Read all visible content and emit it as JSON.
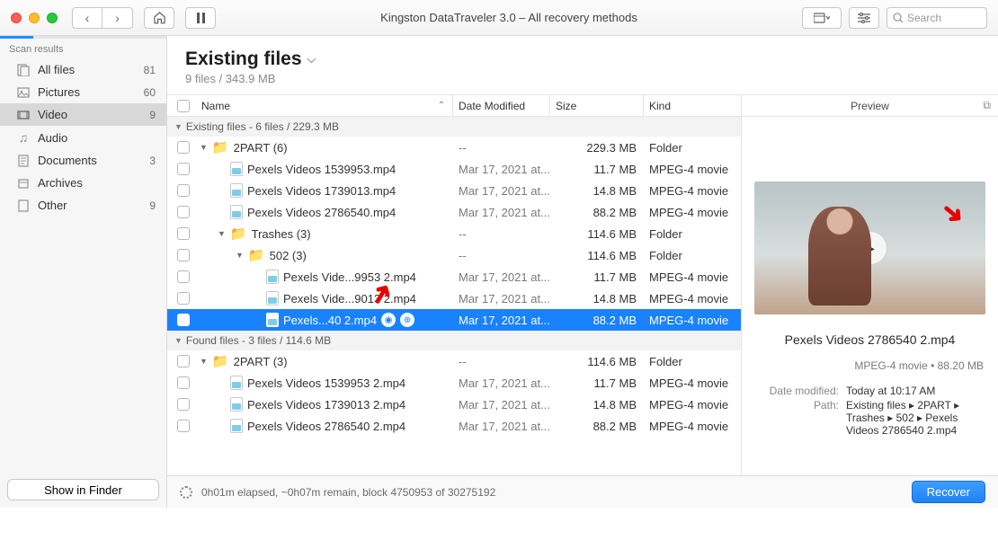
{
  "titlebar": {
    "title": "Kingston DataTraveler 3.0 – All recovery methods",
    "search_placeholder": "Search"
  },
  "sidebar": {
    "header": "Scan results",
    "items": [
      {
        "label": "All files",
        "count": "81"
      },
      {
        "label": "Pictures",
        "count": "60"
      },
      {
        "label": "Video",
        "count": "9"
      },
      {
        "label": "Audio",
        "count": ""
      },
      {
        "label": "Documents",
        "count": "3"
      },
      {
        "label": "Archives",
        "count": ""
      },
      {
        "label": "Other",
        "count": "9"
      }
    ],
    "show_in_finder": "Show in Finder"
  },
  "header": {
    "title": "Existing files",
    "subtitle": "9 files / 343.9 MB"
  },
  "columns": {
    "name": "Name",
    "date": "Date Modified",
    "size": "Size",
    "kind": "Kind"
  },
  "groups": {
    "existing": "Existing files - 6 files / 229.3 MB",
    "found": "Found files - 3 files / 114.6 MB"
  },
  "rows": [
    {
      "type": "folder",
      "indent": 1,
      "name": "2PART (6)",
      "date": "--",
      "size": "229.3 MB",
      "kind": "Folder"
    },
    {
      "type": "file",
      "indent": 2,
      "name": "Pexels Videos 1539953.mp4",
      "date": "Mar 17, 2021 at...",
      "size": "11.7 MB",
      "kind": "MPEG-4 movie"
    },
    {
      "type": "file",
      "indent": 2,
      "name": "Pexels Videos 1739013.mp4",
      "date": "Mar 17, 2021 at...",
      "size": "14.8 MB",
      "kind": "MPEG-4 movie"
    },
    {
      "type": "file",
      "indent": 2,
      "name": "Pexels Videos 2786540.mp4",
      "date": "Mar 17, 2021 at...",
      "size": "88.2 MB",
      "kind": "MPEG-4 movie"
    },
    {
      "type": "folder",
      "indent": 2,
      "name": "Trashes (3)",
      "date": "--",
      "size": "114.6 MB",
      "kind": "Folder"
    },
    {
      "type": "folder",
      "indent": 3,
      "name": "502 (3)",
      "date": "--",
      "size": "114.6 MB",
      "kind": "Folder"
    },
    {
      "type": "file",
      "indent": 4,
      "name": "Pexels Vide...9953 2.mp4",
      "date": "Mar 17, 2021 at...",
      "size": "11.7 MB",
      "kind": "MPEG-4 movie"
    },
    {
      "type": "file",
      "indent": 4,
      "name": "Pexels Vide...9013 2.mp4",
      "date": "Mar 17, 2021 at...",
      "size": "14.8 MB",
      "kind": "MPEG-4 movie"
    },
    {
      "type": "file",
      "indent": 4,
      "name": "Pexels...40 2.mp4",
      "date": "Mar 17, 2021 at...",
      "size": "88.2 MB",
      "kind": "MPEG-4 movie",
      "selected": true
    },
    {
      "type": "folder",
      "indent": 1,
      "name": "2PART (3)",
      "date": "--",
      "size": "114.6 MB",
      "kind": "Folder"
    },
    {
      "type": "file",
      "indent": 2,
      "name": "Pexels Videos 1539953 2.mp4",
      "date": "Mar 17, 2021 at...",
      "size": "11.7 MB",
      "kind": "MPEG-4 movie"
    },
    {
      "type": "file",
      "indent": 2,
      "name": "Pexels Videos 1739013 2.mp4",
      "date": "Mar 17, 2021 at...",
      "size": "14.8 MB",
      "kind": "MPEG-4 movie"
    },
    {
      "type": "file",
      "indent": 2,
      "name": "Pexels Videos 2786540 2.mp4",
      "date": "Mar 17, 2021 at...",
      "size": "88.2 MB",
      "kind": "MPEG-4 movie"
    }
  ],
  "preview": {
    "header": "Preview",
    "title": "Pexels Videos 2786540 2.mp4",
    "meta": "MPEG-4 movie • 88.20 MB",
    "date_modified_label": "Date modified:",
    "date_modified_value": "Today at 10:17 AM",
    "path_label": "Path:",
    "path_value": "Existing files ▸ 2PART ▸ Trashes ▸ 502 ▸ Pexels Videos 2786540 2.mp4"
  },
  "footer": {
    "status": "0h01m elapsed, ~0h07m remain, block 4750953 of 30275192",
    "recover": "Recover"
  }
}
